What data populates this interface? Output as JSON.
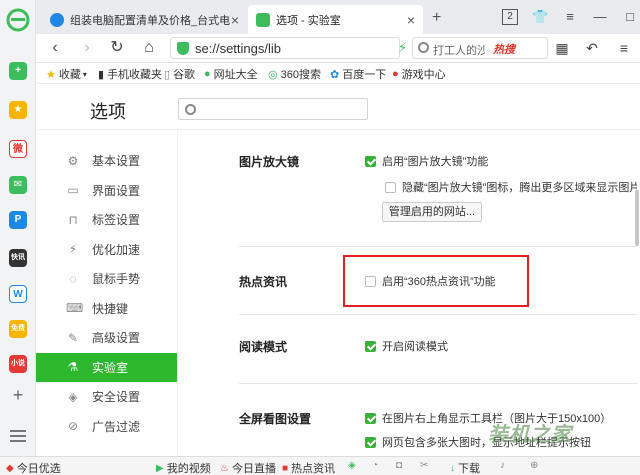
{
  "appbar": {
    "icons": [
      "browser-logo-icon",
      "add-app-icon",
      "favorites-star-icon",
      "weibo-icon",
      "mail-icon",
      "pay-icon",
      "news-icon",
      "docs-icon",
      "game-icon",
      "shop-icon"
    ],
    "colors": {
      "green": "#3dbd5d",
      "yellow": "#f7b500",
      "red": "#e53935",
      "blue": "#1e88e5"
    }
  },
  "tabs": [
    {
      "label": "组装电脑配置清单及价格_台式电",
      "active": false
    },
    {
      "label": "选项 - 实验室",
      "active": true
    }
  ],
  "window_controls": {
    "tab_count": "2"
  },
  "address": {
    "url": "se://settings/lib",
    "search_text": "打工人的沙",
    "hot_badge": "热搜"
  },
  "bookmarks": [
    {
      "label": "收藏",
      "icon": "star-icon"
    },
    {
      "label": "手机收藏夹",
      "icon": "phone-icon"
    },
    {
      "label": "谷歌",
      "icon": "page-icon"
    },
    {
      "label": "网址大全",
      "icon": "site-icon"
    },
    {
      "label": "360搜索",
      "icon": "search-360-icon"
    },
    {
      "label": "百度一下",
      "icon": "baidu-icon"
    },
    {
      "label": "游戏中心",
      "icon": "game-icon"
    }
  ],
  "settings": {
    "title": "选项",
    "search_placeholder": "",
    "menu": [
      {
        "label": "基本设置",
        "icon": "gear-icon",
        "active": false
      },
      {
        "label": "界面设置",
        "icon": "window-icon",
        "active": false
      },
      {
        "label": "标签设置",
        "icon": "tab-icon",
        "active": false
      },
      {
        "label": "优化加速",
        "icon": "lightning-icon",
        "active": false
      },
      {
        "label": "鼠标手势",
        "icon": "mouse-icon",
        "active": false
      },
      {
        "label": "快捷键",
        "icon": "keyboard-icon",
        "active": false
      },
      {
        "label": "高级设置",
        "icon": "wrench-icon",
        "active": false
      },
      {
        "label": "实验室",
        "icon": "flask-icon",
        "active": true
      },
      {
        "label": "安全设置",
        "icon": "shield-icon",
        "active": false
      },
      {
        "label": "广告过滤",
        "icon": "block-icon",
        "active": false
      }
    ],
    "sections": {
      "magnifier": {
        "title": "图片放大镜",
        "opt1": "启用“图片放大镜”功能",
        "opt2": "隐藏“图片放大镜”图标，腾出更多区域来显示图片",
        "button": "管理启用的网站..."
      },
      "hotnews": {
        "title": "热点资讯",
        "opt1": "启用“360热点资讯”功能"
      },
      "reading": {
        "title": "阅读模式",
        "opt1": "开启阅读模式"
      },
      "fullscreen": {
        "title": "全屏看图设置",
        "opt1": "在图片右上角显示工具栏（图片大于150x100）",
        "opt2": "网页包含多张大图时，显示地址栏提示按钮"
      }
    }
  },
  "statusbar": [
    {
      "label": "今日优选",
      "icon": "shop-icon"
    },
    {
      "label": "我的视频",
      "icon": "video-icon"
    },
    {
      "label": "今日直播",
      "icon": "fire-icon"
    },
    {
      "label": "热点资讯",
      "icon": "news-icon"
    },
    {
      "label": "下载",
      "icon": "download-icon"
    }
  ],
  "watermark": "装机之家"
}
